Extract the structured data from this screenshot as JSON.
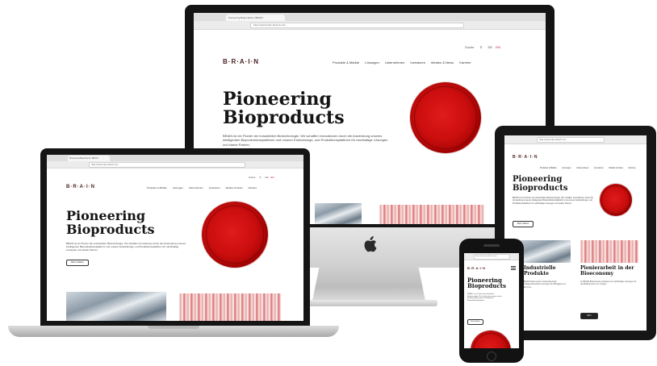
{
  "site": {
    "logo": "B·R·A·I·N",
    "headline_line1": "Pioneering",
    "headline_line2": "Bioproducts",
    "intro": "BRAIN ist ein Pionier der industriellen Biotechnologie. Wir schaffen Innovationen durch die Anwendung unseres intelligenten Bioproduktionsplattform und unserer Entwicklungs- und Produktionsplattform für nachhaltige Lösungen und starke Partner.",
    "intro_short": "BRAIN ist ein Pionier der industriellen Biotechnologie. Wir schaffen Innovationen durch die Anwendung unseres intelligenten Bioproduktionsplattform.",
    "more_button": "Mehr erfahren",
    "nav": [
      "Produkte & Märkte",
      "Lösungen",
      "Unternehmen",
      "Investoren",
      "Medien & News",
      "Karriere"
    ],
    "search_label": "Suche",
    "lang_de": "DE",
    "lang_en": "EN",
    "browser_tab": "Pioneering Bioproducts | BRAIN",
    "url": "https://www.brain-biotech.com",
    "tablet_heading_1": "Industrielle Produkte",
    "tablet_heading_2": "Pionierarbeit in der Bioeconomy",
    "tablet_text_1": "BRAIN bietet seinen Industriekunden maßgeschneiderte Lösungen für Biologika und Enzyme.",
    "tablet_text_2": "Im BRAIN BiotechLab entwickeln wir nachhaltige Lösungen für die Bioökonomie von morgen.",
    "tablet_button": "Mehr"
  }
}
